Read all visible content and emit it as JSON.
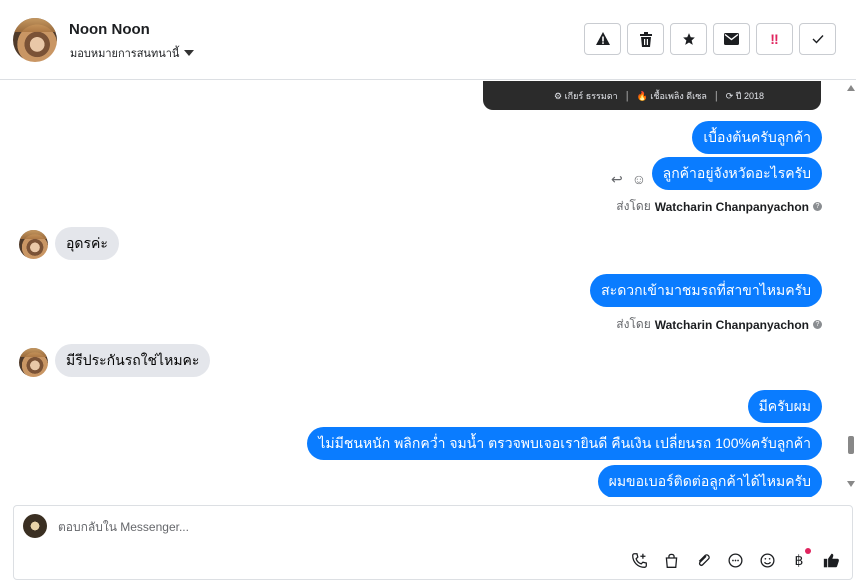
{
  "header": {
    "contact_name": "Noon Noon",
    "assign_label": "มอบหมายการสนทนานี้",
    "actions": [
      {
        "name": "spam-button",
        "icon": "warning-icon",
        "glyph": "▲"
      },
      {
        "name": "delete-button",
        "icon": "trash-icon",
        "glyph": "🗑"
      },
      {
        "name": "star-button",
        "icon": "star-icon",
        "glyph": "★"
      },
      {
        "name": "unread-button",
        "icon": "envelope-icon",
        "glyph": "✉"
      },
      {
        "name": "follow-up-button",
        "icon": "exclamation-icon",
        "glyph": "‼"
      },
      {
        "name": "done-button",
        "icon": "check-icon",
        "glyph": "✓"
      }
    ]
  },
  "card": {
    "gear": "⚙ เกียร์ ธรรมดา",
    "fuel": "🔥 เชื้อเพลิง ดีเซล",
    "year": "⟳ ปี 2018"
  },
  "messages": {
    "m1": "เบื้องต้นครับลูกค้า",
    "m2": "ลูกค้าอยู่จังหวัดอะไรครับ",
    "m3": "อุดรค่ะ",
    "m4": "สะดวกเข้ามาชมรถที่สาขาไหมครับ",
    "m5": "มีรีประกันรถใช่ไหมคะ",
    "m6": "มีครับผม",
    "m7": "ไม่มีชนหนัก พลิกคว่ำ จมน้ำ ตรวจพบเจอเรายินดี คืนเงิน เปลี่ยนรถ 100%ครับลูกค้า",
    "m8": "ผมขอเบอร์ติดต่อลูกค้าได้ไหมครับ"
  },
  "sent_by": {
    "prefix": "ส่งโดย",
    "agent": "Watcharin Chanpanyachon"
  },
  "composer": {
    "placeholder": "ตอบกลับใน Messenger...",
    "tools": [
      "call-plus-icon",
      "shopping-bag-icon",
      "paperclip-icon",
      "chat-bubble-icon",
      "smiley-icon",
      "baht-icon",
      "thumbs-up-icon"
    ]
  },
  "colors": {
    "outgoing_bubble": "#0a7cff",
    "incoming_bubble": "#e4e6eb",
    "notification_dot": "#e0245e"
  }
}
